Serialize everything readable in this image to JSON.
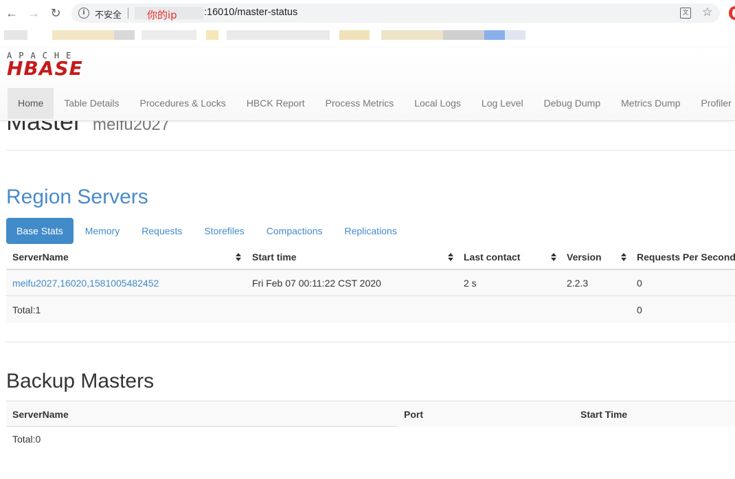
{
  "browser": {
    "insecure_label": "不安全",
    "ip_note": "你的ip",
    "url_rest": ":16010/master-status"
  },
  "logo": {
    "apache": "APACHE",
    "hbase": "HBASE"
  },
  "nav": {
    "items": [
      {
        "label": "Home",
        "active": true
      },
      {
        "label": "Table Details"
      },
      {
        "label": "Procedures & Locks"
      },
      {
        "label": "HBCK Report"
      },
      {
        "label": "Process Metrics"
      },
      {
        "label": "Local Logs"
      },
      {
        "label": "Log Level"
      },
      {
        "label": "Debug Dump"
      },
      {
        "label": "Metrics Dump"
      },
      {
        "label": "Profiler"
      }
    ]
  },
  "master": {
    "title": "Master",
    "hostname": "meifu2027"
  },
  "region_servers": {
    "title": "Region Servers",
    "tabs": [
      "Base Stats",
      "Memory",
      "Requests",
      "Storefiles",
      "Compactions",
      "Replications"
    ],
    "columns": [
      "ServerName",
      "Start time",
      "Last contact",
      "Version",
      "Requests Per Second"
    ],
    "rows": [
      [
        "meifu2027,16020,1581005482452",
        "Fri Feb 07 00:11:22 CST 2020",
        "2 s",
        "2.2.3",
        "0"
      ]
    ],
    "total_label": "Total:1",
    "total_requests": "0"
  },
  "backup_masters": {
    "title": "Backup Masters",
    "columns": [
      "ServerName",
      "Port",
      "Start Time"
    ],
    "total_label": "Total:0"
  }
}
